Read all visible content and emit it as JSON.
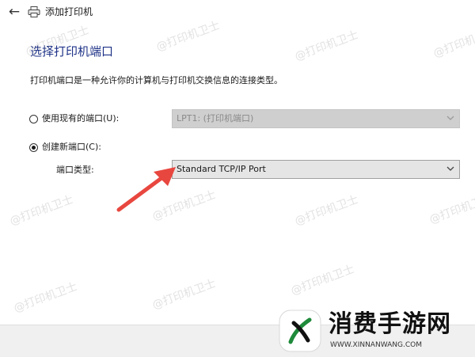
{
  "titlebar": {
    "back_icon": "back-arrow-icon",
    "app_icon": "printer-icon",
    "title": "添加打印机"
  },
  "page": {
    "heading": "选择打印机端口",
    "description": "打印机端口是一种允许你的计算机与打印机交换信息的连接类型。"
  },
  "options": {
    "existing_port": {
      "label": "使用现有的端口(U):",
      "selected": false,
      "value": "LPT1: (打印机端口)",
      "enabled": false
    },
    "new_port": {
      "label": "创建新端口(C):",
      "selected": true,
      "type_label": "端口类型:",
      "value": "Standard TCP/IP Port",
      "enabled": true
    }
  },
  "annotation": {
    "arrow_color": "#e8473f"
  },
  "watermark": {
    "text": "@打印机卫士"
  },
  "site_badge": {
    "name": "消费手游网",
    "url": "WWW.XINNANWANG.COM",
    "logo_color": "#1e8a3a"
  },
  "colors": {
    "heading": "#1e3287",
    "select_bg": "#e5e5e5",
    "select_disabled_bg": "#cfcfcf"
  }
}
